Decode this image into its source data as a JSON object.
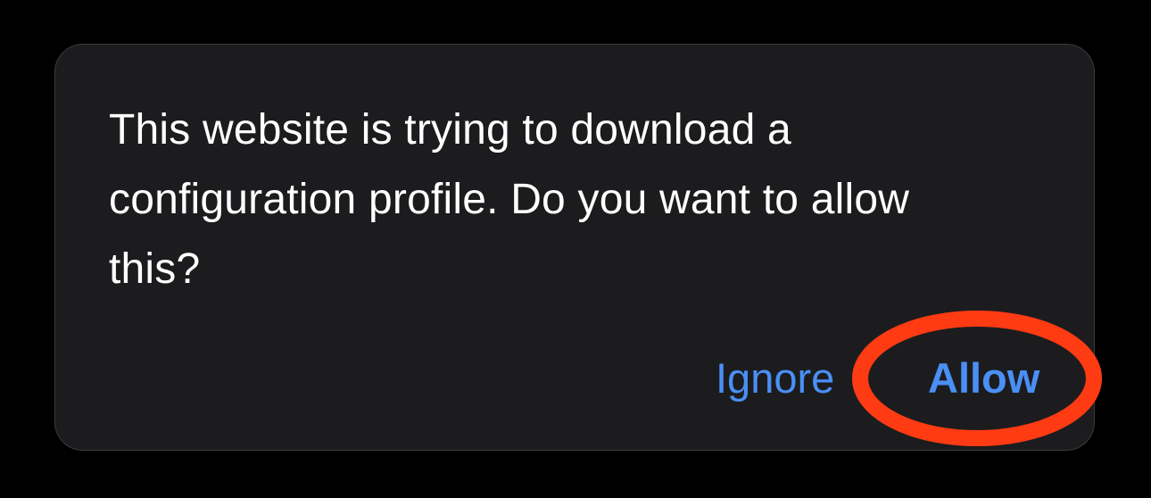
{
  "dialog": {
    "message": "This website is trying to download a configuration profile. Do you want to allow this?",
    "buttons": {
      "ignore_label": "Ignore",
      "allow_label": "Allow"
    }
  },
  "colors": {
    "background": "#000000",
    "dialog_background": "#1c1c1e",
    "text": "#ffffff",
    "button_accent": "#4a8ff5",
    "highlight_ring": "#ff3b14"
  }
}
